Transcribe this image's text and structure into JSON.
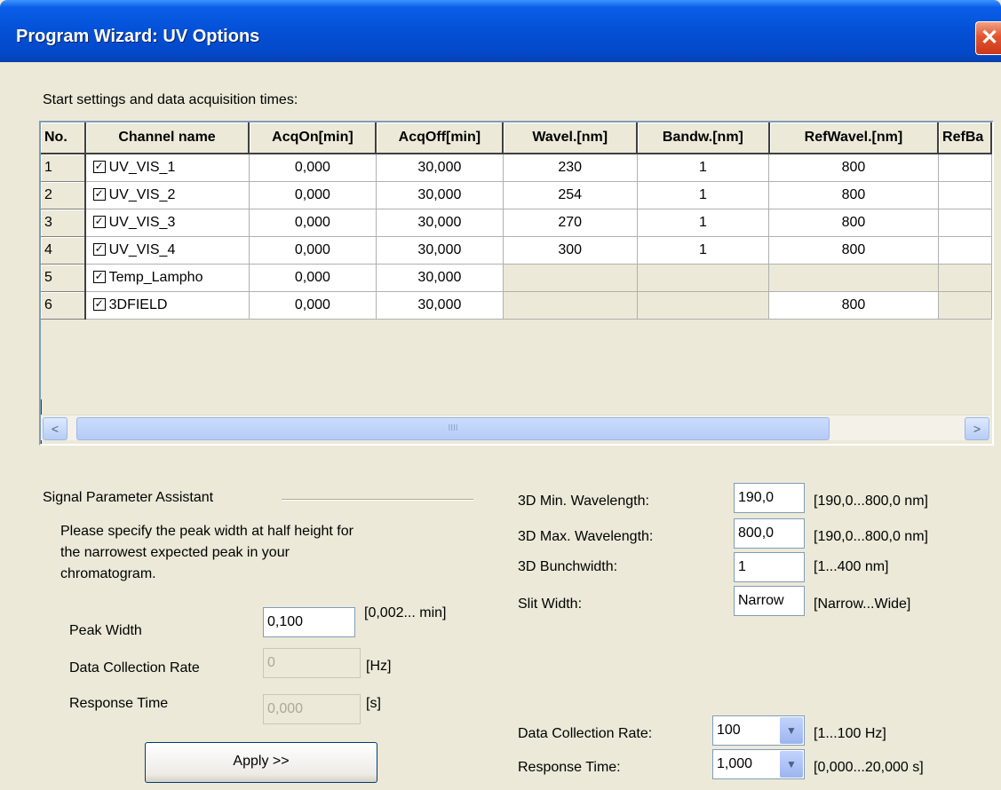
{
  "window": {
    "title": "Program Wizard: UV Options",
    "close_glyph": "✕"
  },
  "table": {
    "caption": "Start settings and data acquisition times:",
    "headers": [
      "No.",
      "Channel name",
      "AcqOn[min]",
      "AcqOff[min]",
      "Wavel.[nm]",
      "Bandw.[nm]",
      "RefWavel.[nm]",
      "RefBa"
    ],
    "rows": [
      {
        "no": "1",
        "checked": true,
        "name": "UV_VIS_1",
        "on": "0,000",
        "off": "30,000",
        "wavel": "230",
        "bandw": "1",
        "refwavel": "800"
      },
      {
        "no": "2",
        "checked": true,
        "name": "UV_VIS_2",
        "on": "0,000",
        "off": "30,000",
        "wavel": "254",
        "bandw": "1",
        "refwavel": "800"
      },
      {
        "no": "3",
        "checked": true,
        "name": "UV_VIS_3",
        "on": "0,000",
        "off": "30,000",
        "wavel": "270",
        "bandw": "1",
        "refwavel": "800"
      },
      {
        "no": "4",
        "checked": true,
        "name": "UV_VIS_4",
        "on": "0,000",
        "off": "30,000",
        "wavel": "300",
        "bandw": "1",
        "refwavel": "800"
      },
      {
        "no": "5",
        "checked": true,
        "name": "Temp_Lampho",
        "on": "0,000",
        "off": "30,000",
        "wavel": "",
        "bandw": "",
        "refwavel": ""
      },
      {
        "no": "6",
        "checked": true,
        "name": "3DFIELD",
        "on": "0,000",
        "off": "30,000",
        "wavel": "",
        "bandw": "",
        "refwavel": "800"
      }
    ],
    "scroll": {
      "left_arrow": "<",
      "right_arrow": ">",
      "thumb_grip": "IIII"
    }
  },
  "assistant": {
    "group_title": "Signal Parameter Assistant",
    "description_lines": [
      "Please specify the peak width at half height for",
      "the narrowest expected peak in your",
      "chromatogram."
    ],
    "peak_width": {
      "label": "Peak Width",
      "value": "0,100",
      "range": "[0,002... min]"
    },
    "data_collection_rate": {
      "label": "Data Collection Rate",
      "value": "0",
      "unit": "[Hz]"
    },
    "response_time": {
      "label": "Response Time",
      "value": "0,000",
      "unit": "[s]"
    },
    "apply_label": "Apply >>"
  },
  "field3d": {
    "min_wavelength": {
      "label": "3D Min. Wavelength:",
      "value": "190,0",
      "range": "[190,0...800,0 nm]"
    },
    "max_wavelength": {
      "label": "3D Max. Wavelength:",
      "value": "800,0",
      "range": "[190,0...800,0 nm]"
    },
    "bunchwidth": {
      "label": "3D Bunchwidth:",
      "value": "1",
      "range": "[1...400 nm]"
    },
    "slit_width": {
      "label": "Slit Width:",
      "value": "Narrow",
      "range": "[Narrow...Wide]"
    }
  },
  "acquisition": {
    "data_collection_rate": {
      "label": "Data Collection Rate:",
      "value": "100",
      "range": "[1...100 Hz]"
    },
    "response_time": {
      "label": "Response Time:",
      "value": "1,000",
      "range": "[0,000...20,000 s]"
    }
  },
  "icons": {
    "checkbox": "checkbox-checked-icon",
    "dropdown": "dropdown-arrow-icon"
  }
}
